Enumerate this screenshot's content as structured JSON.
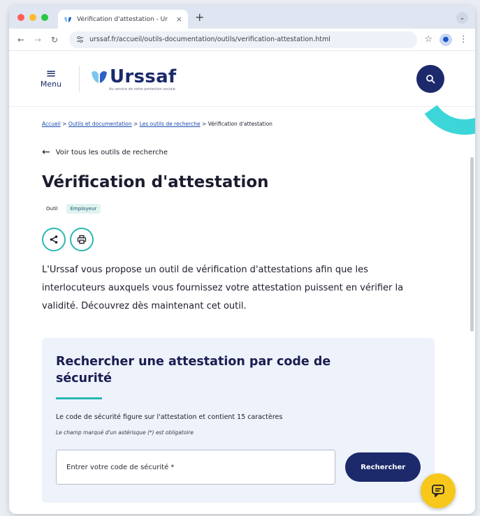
{
  "browser": {
    "tab_title": "Vérification d'attestation - Ur",
    "tab_close": "×",
    "new_tab": "+",
    "tab_menu": "⌄",
    "url": "urssaf.fr/accueil/outils-documentation/outils/verification-attestation.html",
    "traffic_colors": [
      "#ff5f57",
      "#febc2e",
      "#28c840"
    ]
  },
  "header": {
    "menu_label": "Menu",
    "logo_text": "Urssaf",
    "logo_tagline": "Au service de notre protection sociale"
  },
  "breadcrumb": {
    "items": [
      "Accueil",
      "Outils et documentation",
      "Les outils de recherche"
    ],
    "separator": " > ",
    "current": "Vérification d'attestation"
  },
  "back_link": "Voir tous les outils de recherche",
  "page_title": "Vérification d'attestation",
  "tags": [
    "Outil",
    "Employeur"
  ],
  "intro": "L'Urssaf vous propose un outil de vérification d'attestations afin que les interlocuteurs auxquels vous fournissez votre attestation puissent en vérifier la validité. Découvrez dès maintenant cet outil.",
  "card": {
    "title": "Rechercher une attestation par code de sécurité",
    "description": "Le code de sécurité figure sur l'attestation et contient 15 caractères",
    "note": "Le champ marqué d'un astérisque (*) est obligatoire",
    "input_placeholder": "Entrer votre code de sécurité *",
    "submit_label": "Rechercher"
  },
  "colors": {
    "brand_navy": "#1c2a6b",
    "accent_teal": "#2bb7b4",
    "chat_yellow": "#f7c81b"
  }
}
